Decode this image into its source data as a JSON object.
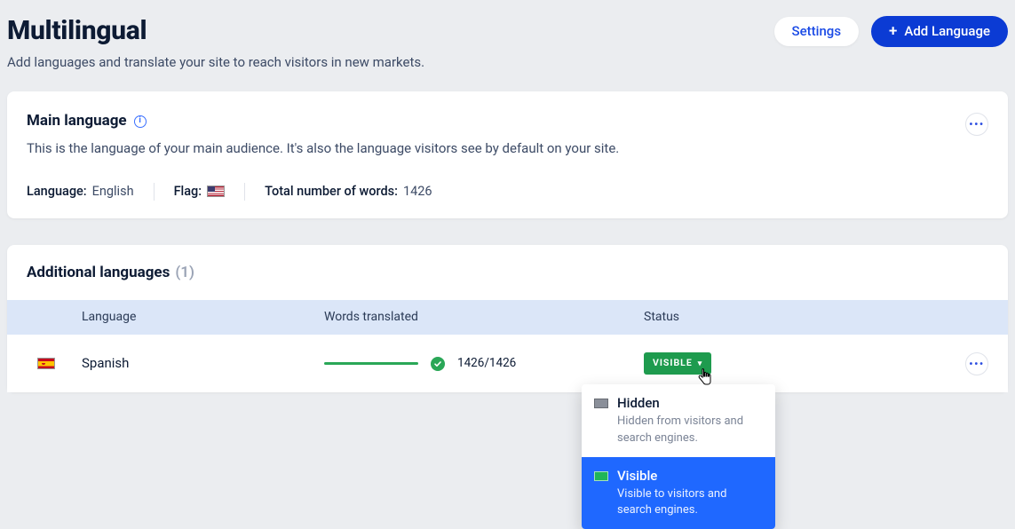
{
  "header": {
    "title": "Multilingual",
    "subtitle": "Add languages and translate your site to reach visitors in new markets.",
    "settings_label": "Settings",
    "add_language_label": "Add Language"
  },
  "main_language": {
    "section_title": "Main language",
    "description": "This is the language of your main audience. It's also the language visitors see by default on your site.",
    "language_label": "Language:",
    "language_value": "English",
    "flag_label": "Flag:",
    "total_words_label": "Total number of words:",
    "total_words_value": "1426"
  },
  "additional": {
    "section_title": "Additional languages",
    "count_text": "(1)",
    "columns": {
      "language": "Language",
      "words": "Words translated",
      "status": "Status"
    },
    "rows": [
      {
        "name": "Spanish",
        "translated_ratio": "1426/1426",
        "status_badge": "VISIBLE"
      }
    ],
    "status_menu": {
      "hidden": {
        "title": "Hidden",
        "desc": "Hidden from visitors and search engines."
      },
      "visible": {
        "title": "Visible",
        "desc": "Visible to visitors and search engines."
      }
    }
  }
}
